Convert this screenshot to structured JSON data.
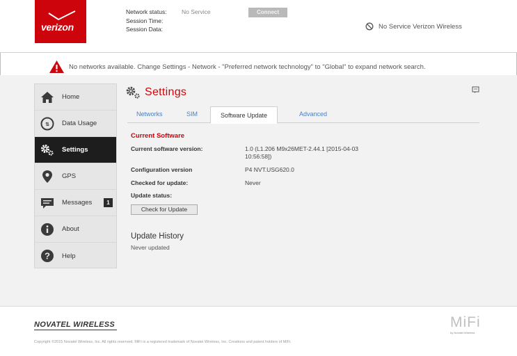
{
  "header": {
    "logo_text": "verizon",
    "network_status_label": "Network status:",
    "network_status_value": "No Service",
    "session_time_label": "Session Time:",
    "session_data_label": "Session Data:",
    "connect_label": "Connect",
    "service_indicator": "No Service  Verizon Wireless"
  },
  "alert": {
    "message": "No networks available. Change Settings - Network - \"Preferred network technology\" to \"Global\" to expand network search."
  },
  "sidebar": {
    "items": [
      {
        "label": "Home",
        "icon": "home-icon"
      },
      {
        "label": "Data Usage",
        "icon": "data-usage-icon"
      },
      {
        "label": "Settings",
        "icon": "settings-icon",
        "active": true
      },
      {
        "label": "GPS",
        "icon": "location-pin-icon"
      },
      {
        "label": "Messages",
        "icon": "message-icon",
        "badge": "1"
      },
      {
        "label": "About",
        "icon": "info-icon"
      },
      {
        "label": "Help",
        "icon": "question-icon"
      }
    ]
  },
  "settings": {
    "title": "Settings",
    "tabs": [
      "Networks",
      "SIM",
      "Software Update",
      "Advanced"
    ],
    "active_tab": "Software Update",
    "current_software": {
      "title": "Current Software",
      "current_version_label": "Current software version:",
      "current_version_value": "1.0 (L1.206 M9x26MET-2.44.1 [2015-04-03 10:56:58])",
      "config_version_label": "Configuration version",
      "config_version_value": "P4 NVT.USG620.0",
      "checked_label": "Checked for update:",
      "checked_value": "Never",
      "update_status_label": "Update status:",
      "check_button": "Check for Update"
    },
    "update_history": {
      "title": "Update History",
      "value": "Never updated"
    }
  },
  "footer": {
    "brand": "NOVATEL WIRELESS",
    "copyright": "Copyright ©2015  Novatel Wireless, Inc. All rights reserved. MiFi is a registered trademark of Novatel Wireless, Inc. Creations and patent holders of MiFi.",
    "mifi": "MiFi",
    "mifi_sub": "by Novatel Wireless"
  },
  "colors": {
    "brand_red": "#cd040b",
    "link_blue": "#4a7fc1",
    "active_nav": "#1d1d1d"
  }
}
